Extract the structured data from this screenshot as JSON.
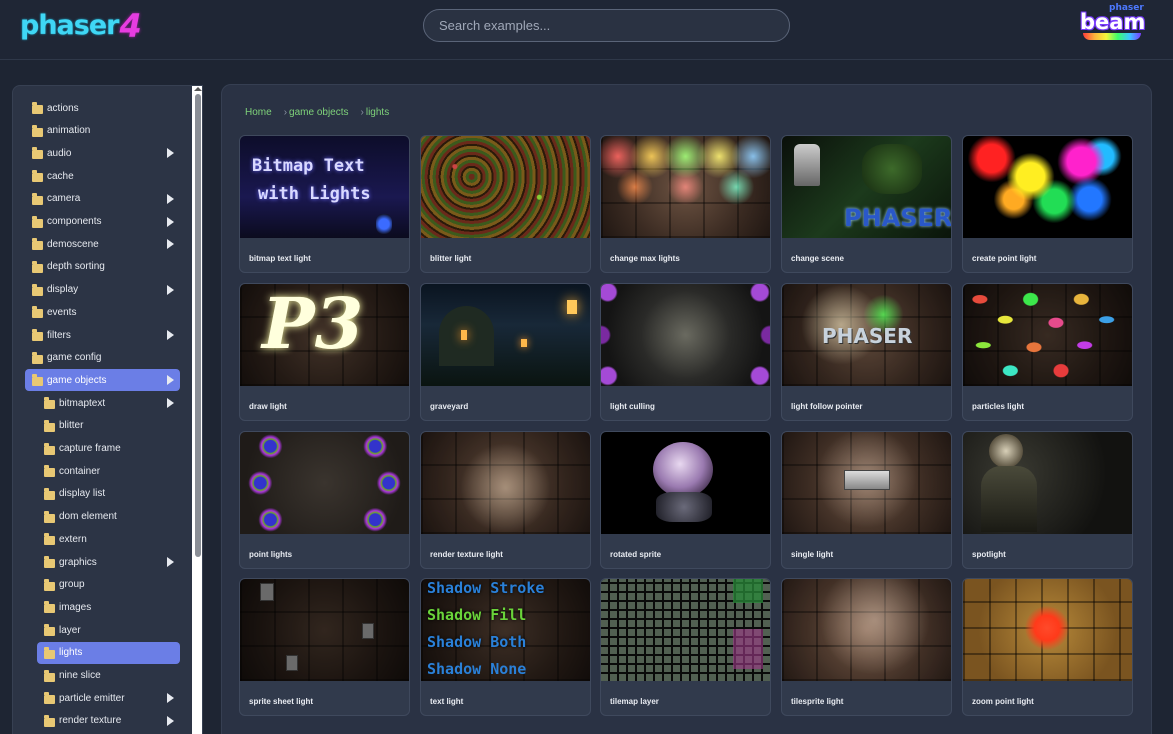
{
  "header": {
    "logo_text": "phaser",
    "logo_number": "4",
    "search_placeholder": "Search examples...",
    "beam_small": "phaser",
    "beam_text": "beam"
  },
  "sidebar": {
    "items": [
      {
        "label": "actions",
        "level": 0,
        "has_children": false,
        "active": false
      },
      {
        "label": "animation",
        "level": 0,
        "has_children": false,
        "active": false
      },
      {
        "label": "audio",
        "level": 0,
        "has_children": true,
        "active": false
      },
      {
        "label": "cache",
        "level": 0,
        "has_children": false,
        "active": false
      },
      {
        "label": "camera",
        "level": 0,
        "has_children": true,
        "active": false
      },
      {
        "label": "components",
        "level": 0,
        "has_children": true,
        "active": false
      },
      {
        "label": "demoscene",
        "level": 0,
        "has_children": true,
        "active": false
      },
      {
        "label": "depth sorting",
        "level": 0,
        "has_children": false,
        "active": false
      },
      {
        "label": "display",
        "level": 0,
        "has_children": true,
        "active": false
      },
      {
        "label": "events",
        "level": 0,
        "has_children": false,
        "active": false
      },
      {
        "label": "filters",
        "level": 0,
        "has_children": true,
        "active": false
      },
      {
        "label": "game config",
        "level": 0,
        "has_children": false,
        "active": false
      },
      {
        "label": "game objects",
        "level": 0,
        "has_children": true,
        "active": true
      },
      {
        "label": "bitmaptext",
        "level": 1,
        "has_children": true,
        "active": false
      },
      {
        "label": "blitter",
        "level": 1,
        "has_children": false,
        "active": false
      },
      {
        "label": "capture frame",
        "level": 1,
        "has_children": false,
        "active": false
      },
      {
        "label": "container",
        "level": 1,
        "has_children": false,
        "active": false
      },
      {
        "label": "display list",
        "level": 1,
        "has_children": false,
        "active": false
      },
      {
        "label": "dom element",
        "level": 1,
        "has_children": false,
        "active": false
      },
      {
        "label": "extern",
        "level": 1,
        "has_children": false,
        "active": false
      },
      {
        "label": "graphics",
        "level": 1,
        "has_children": true,
        "active": false
      },
      {
        "label": "group",
        "level": 1,
        "has_children": false,
        "active": false
      },
      {
        "label": "images",
        "level": 1,
        "has_children": false,
        "active": false
      },
      {
        "label": "layer",
        "level": 1,
        "has_children": false,
        "active": false
      },
      {
        "label": "lights",
        "level": 1,
        "has_children": false,
        "active": true
      },
      {
        "label": "nine slice",
        "level": 1,
        "has_children": false,
        "active": false
      },
      {
        "label": "particle emitter",
        "level": 1,
        "has_children": true,
        "active": false
      },
      {
        "label": "render texture",
        "level": 1,
        "has_children": true,
        "active": false
      }
    ]
  },
  "breadcrumb": {
    "home": "Home",
    "level1": "game objects",
    "level2": "lights",
    "separator": "›"
  },
  "examples": [
    {
      "label": "bitmap text light",
      "thumb": "bitmap",
      "thumb_text": [
        "Bitmap Text",
        "with Lights"
      ]
    },
    {
      "label": "blitter light",
      "thumb": "blitter"
    },
    {
      "label": "change max lights",
      "thumb": "maxlights"
    },
    {
      "label": "change scene",
      "thumb": "scene",
      "thumb_text": [
        "PHASER"
      ]
    },
    {
      "label": "create point light",
      "thumb": "pointlight"
    },
    {
      "label": "draw light",
      "thumb": "draw",
      "thumb_text": [
        "P3"
      ]
    },
    {
      "label": "graveyard",
      "thumb": "graveyard"
    },
    {
      "label": "light culling",
      "thumb": "culling"
    },
    {
      "label": "light follow pointer",
      "thumb": "follow",
      "thumb_text": [
        "PHASER"
      ]
    },
    {
      "label": "particles light",
      "thumb": "particles"
    },
    {
      "label": "point lights",
      "thumb": "points"
    },
    {
      "label": "render texture light",
      "thumb": "rtlight"
    },
    {
      "label": "rotated sprite",
      "thumb": "rotated"
    },
    {
      "label": "single light",
      "thumb": "single"
    },
    {
      "label": "spotlight",
      "thumb": "spot"
    },
    {
      "label": "sprite sheet light",
      "thumb": "sheet"
    },
    {
      "label": "text light",
      "thumb": "textlight",
      "thumb_text": [
        "Shadow Stroke",
        "Shadow Fill",
        "Shadow Both",
        "Shadow None"
      ]
    },
    {
      "label": "tilemap layer",
      "thumb": "tilemap"
    },
    {
      "label": "tilesprite light",
      "thumb": "tilesprite"
    },
    {
      "label": "zoom point light",
      "thumb": "zoom"
    }
  ],
  "colors": {
    "accent": "#6b7ee6",
    "breadcrumb": "#7fd27a",
    "folder": "#e8c874",
    "background": "#1e2533"
  }
}
